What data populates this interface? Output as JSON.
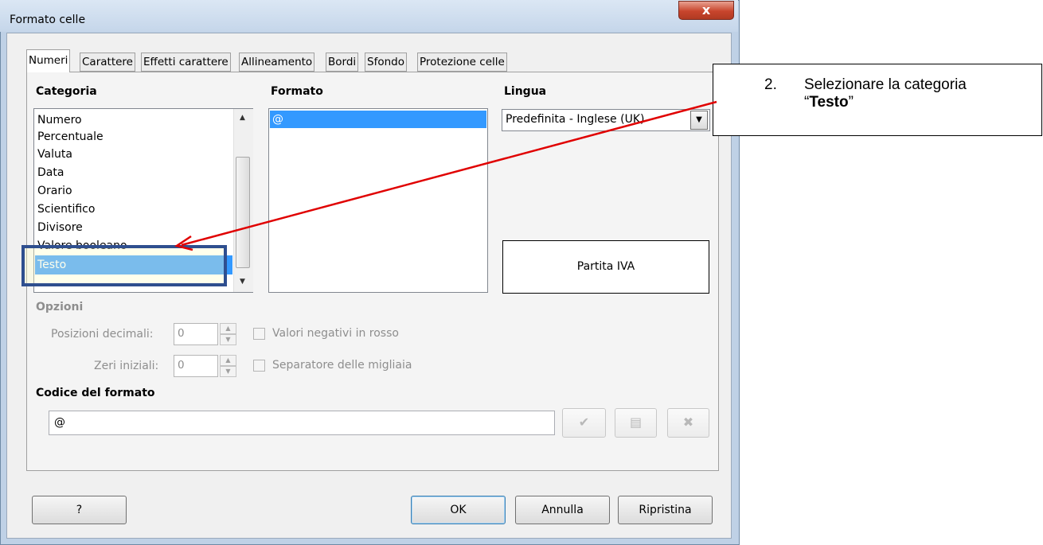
{
  "window": {
    "title": "Formato celle",
    "close_glyph": "x"
  },
  "tabs": [
    "Numeri",
    "Carattere",
    "Effetti carattere",
    "Allineamento",
    "Bordi",
    "Sfondo",
    "Protezione celle"
  ],
  "categoria": {
    "label": "Categoria",
    "items": [
      "Numero",
      "Percentuale",
      "Valuta",
      "Data",
      "Orario",
      "Scientifico",
      "Divisore",
      "Valore booleano",
      "Testo"
    ],
    "selected": "Testo"
  },
  "formato": {
    "label": "Formato",
    "items": [
      "@"
    ],
    "selected": "@"
  },
  "lingua": {
    "label": "Lingua",
    "value": "Predefinita - Inglese (UK)"
  },
  "preview": {
    "text": "Partita IVA"
  },
  "opzioni": {
    "label": "Opzioni",
    "decimali_label": "Posizioni decimali:",
    "decimali_value": "0",
    "zeri_label": "Zeri iniziali:",
    "zeri_value": "0",
    "negativi_label": "Valori negativi in rosso",
    "separatore_label": "Separatore delle migliaia"
  },
  "codice": {
    "label": "Codice del formato",
    "value": "@"
  },
  "buttons": {
    "help": "?",
    "ok": "OK",
    "cancel": "Annulla",
    "reset": "Ripristina"
  },
  "callout": {
    "number": "2.",
    "text_prefix": "Selezionare la categoria",
    "open_quote": "“",
    "bold": "Testo",
    "close_quote": "”"
  },
  "colors": {
    "selection": "#3399ff",
    "annotation_arrow": "#e00000",
    "highlight_box": "#2f4f8f",
    "highlight_fill": "#ffffcc"
  },
  "icons": [
    "close-icon",
    "scroll-up-icon",
    "scroll-down-icon",
    "dropdown-arrow-icon",
    "checkmark-icon",
    "add-format-icon",
    "delete-icon"
  ]
}
